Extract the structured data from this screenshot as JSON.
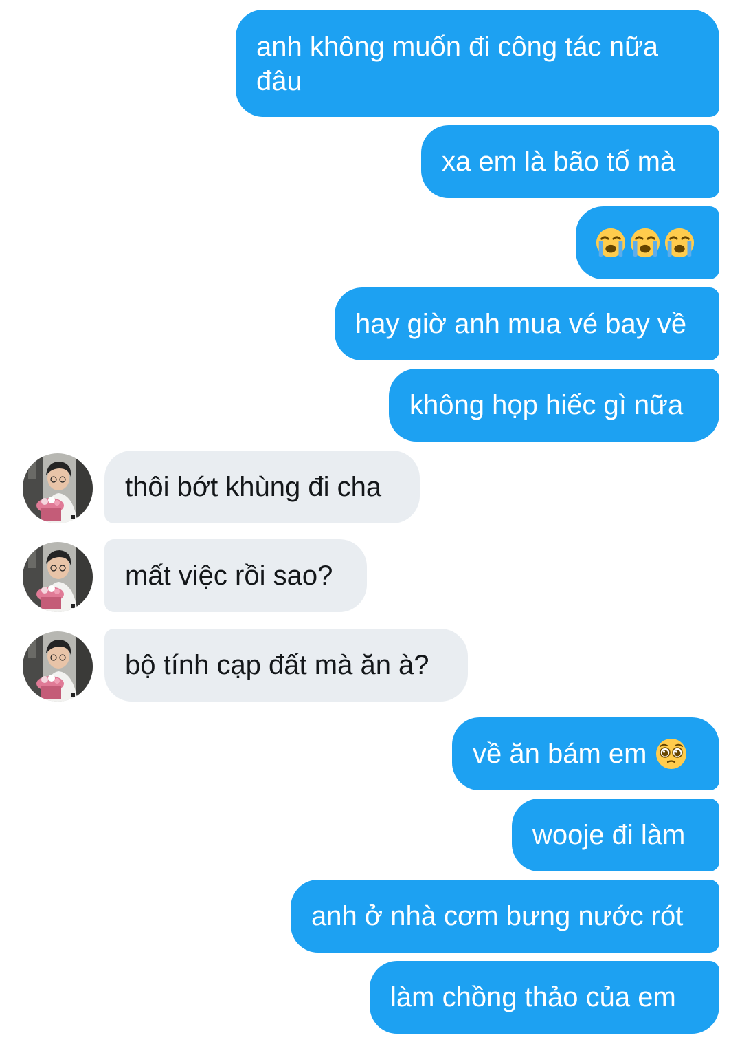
{
  "conversation": {
    "messages": [
      {
        "sender": "me",
        "text": "anh không muốn đi công tác nữa đâu"
      },
      {
        "sender": "me",
        "text": "xa em là bão tố mà"
      },
      {
        "sender": "me",
        "text": "",
        "emojis": [
          "loudly-crying-face",
          "loudly-crying-face",
          "loudly-crying-face"
        ]
      },
      {
        "sender": "me",
        "text": "hay giờ anh mua vé bay về"
      },
      {
        "sender": "me",
        "text": "không họp hiếc gì nữa"
      },
      {
        "sender": "them",
        "text": "thôi bớt khùng đi cha"
      },
      {
        "sender": "them",
        "text": "mất việc rồi sao?"
      },
      {
        "sender": "them",
        "text": "bộ tính cạp đất mà ăn à?"
      },
      {
        "sender": "me",
        "text": "về ăn bám em",
        "emojis": [
          "pleading-face"
        ]
      },
      {
        "sender": "me",
        "text": "wooje đi làm"
      },
      {
        "sender": "me",
        "text": "anh ở nhà cơm bưng nước rót"
      },
      {
        "sender": "me",
        "text": "làm chồng thảo của em"
      }
    ]
  },
  "colors": {
    "outgoing_bubble": "#1da1f2",
    "outgoing_text": "#ffffff",
    "incoming_bubble": "#e9edf1",
    "incoming_text": "#14171a",
    "background": "#ffffff"
  }
}
